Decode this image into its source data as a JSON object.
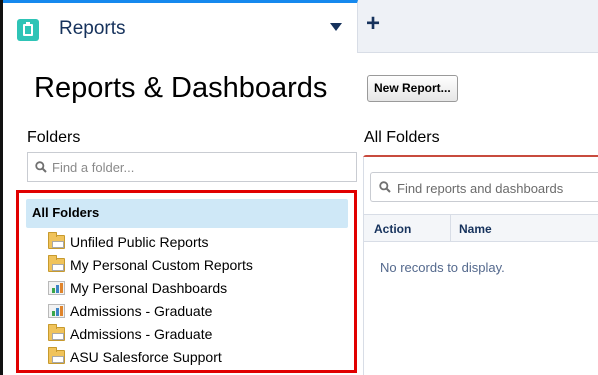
{
  "tab": {
    "title": "Reports",
    "icon": "reports-icon",
    "add_icon": "+"
  },
  "page": {
    "title": "Reports & Dashboards",
    "new_report_label": "New Report..."
  },
  "folders": {
    "label": "Folders",
    "search_placeholder": "Find a folder...",
    "all_folders_label": "All Folders",
    "items": [
      {
        "label": "Unfiled Public Reports",
        "icon": "folder-icon"
      },
      {
        "label": "My Personal Custom Reports",
        "icon": "folder-icon"
      },
      {
        "label": "My Personal Dashboards",
        "icon": "dashboard-icon"
      },
      {
        "label": "Admissions - Graduate",
        "icon": "dashboard-icon"
      },
      {
        "label": "Admissions - Graduate",
        "icon": "folder-icon"
      },
      {
        "label": "ASU Salesforce Support",
        "icon": "folder-icon"
      }
    ]
  },
  "panel": {
    "label": "All Folders",
    "search_placeholder": "Find reports and dashboards",
    "columns": [
      "Action",
      "Name"
    ],
    "empty_text": "No records to display."
  },
  "colors": {
    "accent": "#1589ee",
    "highlight": "#e10000",
    "selected_bg": "#cfe8f7",
    "panel_top": "#c84b3e"
  }
}
